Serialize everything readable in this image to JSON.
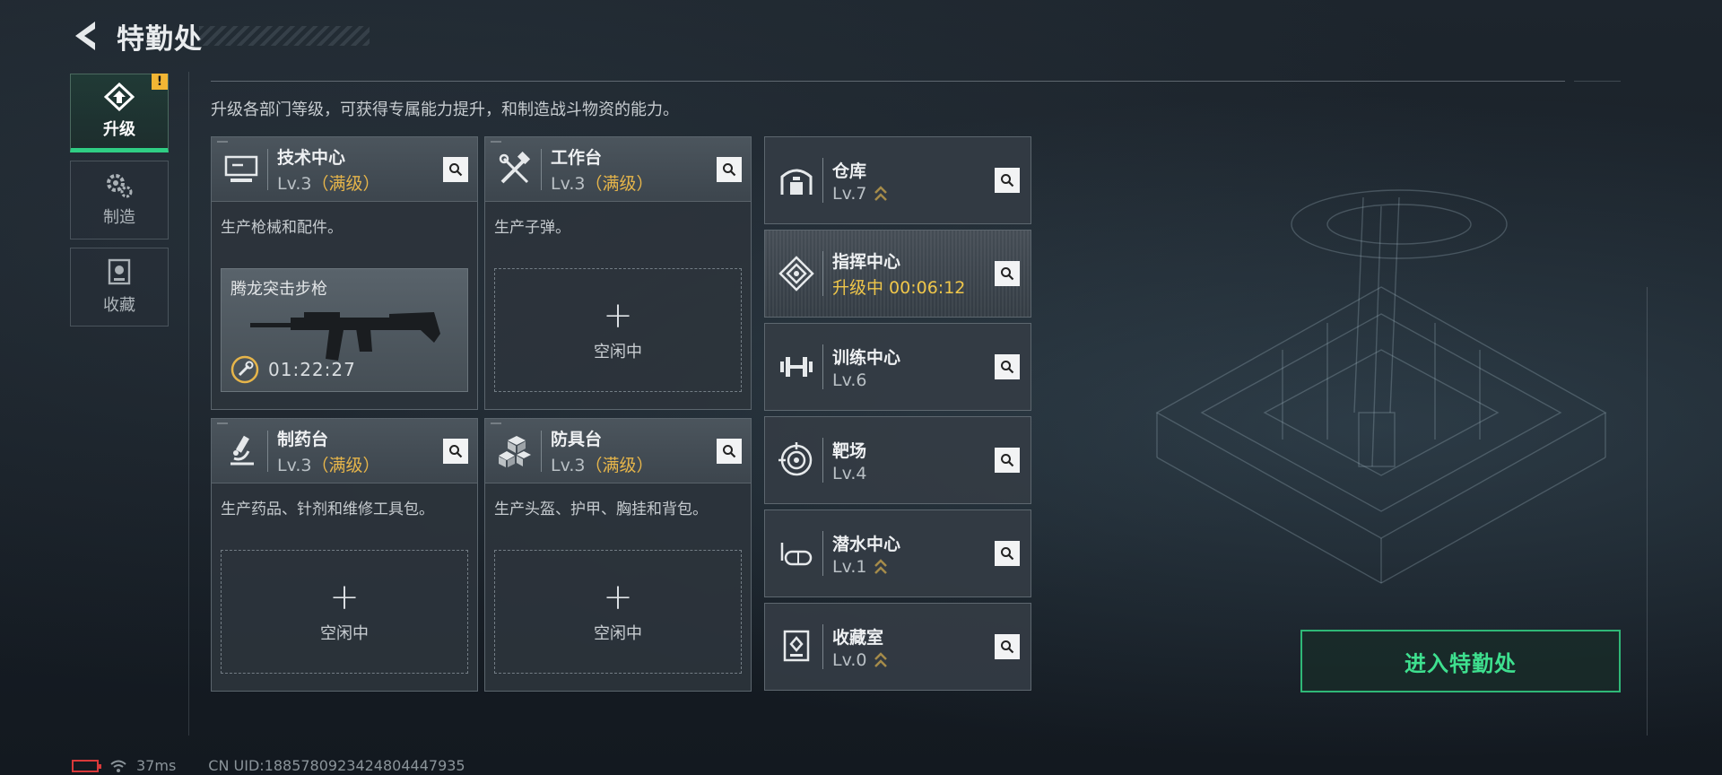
{
  "header": {
    "title": "特勤处"
  },
  "nav": [
    {
      "id": "upgrade",
      "label": "升级",
      "active": true,
      "badge": "!"
    },
    {
      "id": "craft",
      "label": "制造",
      "active": false
    },
    {
      "id": "collect",
      "label": "收藏",
      "active": false
    }
  ],
  "description": "升级各部门等级，可获得专属能力提升，和制造战斗物资的能力。",
  "cards": {
    "tech": {
      "name": "技术中心",
      "lv": "Lv.3",
      "max": "（满级）",
      "desc": "生产枪械和配件。",
      "product": {
        "name": "腾龙突击步枪",
        "time": "01:22:27"
      }
    },
    "workbench": {
      "name": "工作台",
      "lv": "Lv.3",
      "max": "（满级）",
      "desc": "生产子弹。",
      "plus": "+",
      "idle": "空闲中"
    },
    "pharmacy": {
      "name": "制药台",
      "lv": "Lv.3",
      "max": "（满级）",
      "desc": "生产药品、针剂和维修工具包。",
      "plus": "+",
      "idle": "空闲中"
    },
    "armor": {
      "name": "防具台",
      "lv": "Lv.3",
      "max": "（满级）",
      "desc": "生产头盔、护甲、胸挂和背包。",
      "plus": "+",
      "idle": "空闲中"
    }
  },
  "facilities": [
    {
      "name": "仓库",
      "lv": "Lv.7",
      "upgradable": true
    },
    {
      "name": "指挥中心",
      "status": "升级中 00:06:12",
      "upgrading": true
    },
    {
      "name": "训练中心",
      "lv": "Lv.6",
      "upgradable": false
    },
    {
      "name": "靶场",
      "lv": "Lv.4",
      "upgradable": false
    },
    {
      "name": "潜水中心",
      "lv": "Lv.1",
      "upgradable": true
    },
    {
      "name": "收藏室",
      "lv": "Lv.0",
      "upgradable": true
    }
  ],
  "enter_button": "进入特勤处",
  "status": {
    "ping": "37ms",
    "uid": "CN UID:1885780923424804447935"
  },
  "colors": {
    "accent_green": "#2fce84",
    "max_gold": "#e6b54a",
    "upgrading_gold": "#f0c74a"
  }
}
